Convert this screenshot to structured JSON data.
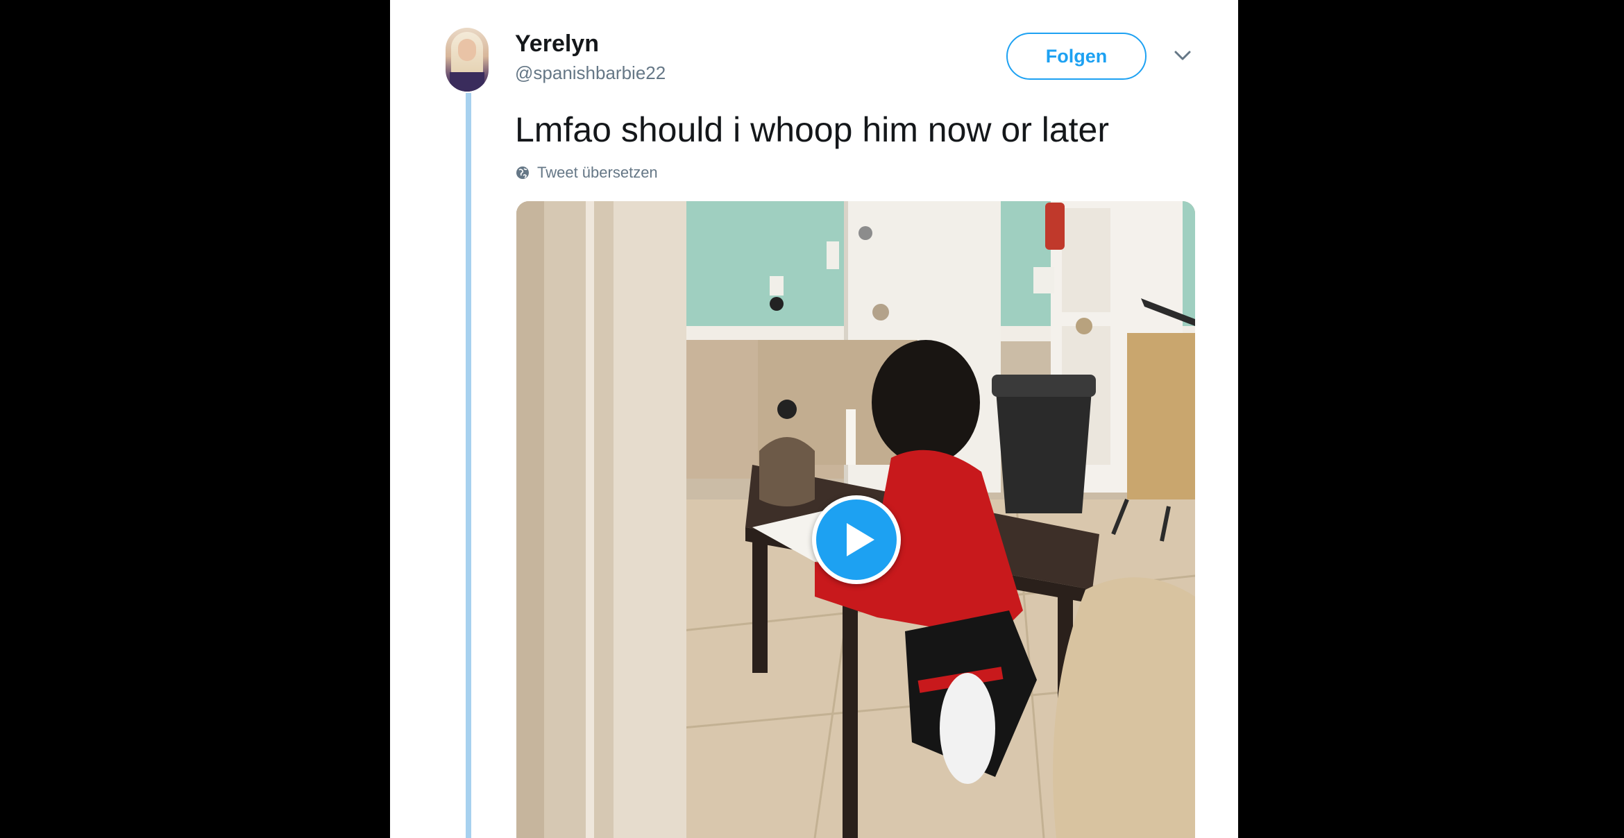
{
  "tweet": {
    "author_name": "Yerelyn",
    "author_handle": "@spanishbarbie22",
    "follow_label": "Folgen",
    "text": "Lmfao should i whoop him now or later",
    "translate_label": "Tweet übersetzen"
  },
  "icons": {
    "menu": "chevron-down-icon",
    "translate": "globe-icon",
    "media": "play-icon"
  },
  "colors": {
    "accent": "#1da1f2",
    "thread_line": "#a7d1ef",
    "text_primary": "#14171a",
    "text_secondary": "#657786",
    "frame_background": "#000000"
  }
}
